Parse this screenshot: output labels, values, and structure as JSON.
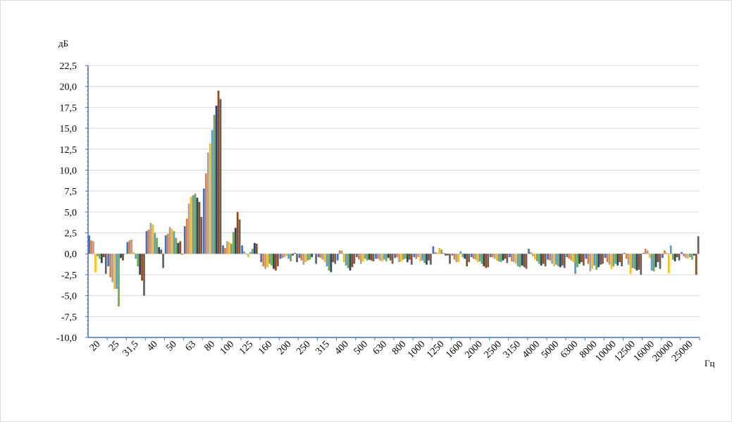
{
  "chart_data": {
    "type": "bar",
    "title": "",
    "ylabel": "дБ",
    "xlabel": "Гц",
    "ylim": [
      -10,
      22.5
    ],
    "yticks": [
      -10,
      -7.5,
      -5,
      -2.5,
      0,
      2.5,
      5,
      7.5,
      10,
      12.5,
      15,
      17.5,
      20,
      22.5
    ],
    "ytick_labels": [
      "-10,0",
      "-7,5",
      "-5,0",
      "-2,5",
      "0,0",
      "2,5",
      "5,0",
      "7,5",
      "10,0",
      "12,5",
      "15,0",
      "17,5",
      "20,0",
      "22,5"
    ],
    "grid": true,
    "legend": "none",
    "categories": [
      "20",
      "25",
      "31,5",
      "40",
      "50",
      "63",
      "80",
      "100",
      "125",
      "160",
      "200",
      "250",
      "315",
      "400",
      "500",
      "630",
      "800",
      "1000",
      "1250",
      "1600",
      "2000",
      "2500",
      "3150",
      "4000",
      "5000",
      "6300",
      "8000",
      "10000",
      "12500",
      "16000",
      "20000",
      "25000"
    ],
    "series_colors": [
      "#4472c4",
      "#ed7d31",
      "#a5a5a5",
      "#ffc000",
      "#5b9bd5",
      "#70ad47",
      "#264478",
      "#9e480e",
      "#636363"
    ],
    "values": [
      [
        2.2,
        1.6,
        1.5,
        -2.2,
        -0.3,
        -0.6,
        -1.1,
        -0.4,
        -2.4
      ],
      [
        -1.5,
        -2.8,
        -3.4,
        -4.2,
        -4.2,
        -6.3,
        -0.5,
        -0.8,
        0.0
      ],
      [
        1.4,
        1.6,
        1.7,
        0.2,
        -0.6,
        -1.5,
        -2.5,
        -3.2,
        -5.0
      ],
      [
        2.7,
        2.9,
        3.7,
        3.5,
        2.5,
        1.9,
        0.8,
        0.5,
        -1.7
      ],
      [
        2.2,
        2.4,
        3.2,
        3.0,
        2.7,
        1.9,
        1.3,
        1.5,
        -0.1
      ],
      [
        3.3,
        4.2,
        6.0,
        6.8,
        7.0,
        7.2,
        6.7,
        6.2,
        4.4
      ],
      [
        7.8,
        9.6,
        12.1,
        13.2,
        14.8,
        16.6,
        17.7,
        19.5,
        18.5
      ],
      [
        1.0,
        0.7,
        1.5,
        1.4,
        1.2,
        2.6,
        3.1,
        5.0,
        4.1
      ],
      [
        1.0,
        0.3,
        -0.1,
        -0.4,
        0.2,
        0.6,
        1.3,
        1.2,
        0.0
      ],
      [
        -1.0,
        -1.5,
        -1.8,
        -1.6,
        -1.2,
        -1.4,
        -1.8,
        -2.0,
        -1.5
      ],
      [
        -0.6,
        -0.5,
        -0.4,
        -0.3,
        -0.6,
        -0.9,
        -0.2,
        0.1,
        -1.0
      ],
      [
        -0.5,
        -0.8,
        -1.3,
        -1.0,
        -0.8,
        -0.7,
        -0.4,
        0.0,
        -1.2
      ],
      [
        -0.4,
        -0.5,
        -0.7,
        -1.0,
        -1.5,
        -2.0,
        -2.2,
        -1.0,
        -1.2
      ],
      [
        -0.8,
        0.4,
        0.4,
        -1.0,
        -1.4,
        -1.7,
        -2.0,
        -1.6,
        -1.2
      ],
      [
        -0.4,
        -0.7,
        -1.2,
        -0.9,
        -0.6,
        -0.8,
        -0.7,
        -0.8,
        -0.9
      ],
      [
        -0.6,
        -0.6,
        -0.8,
        -0.9,
        -0.7,
        -0.9,
        -0.5,
        -0.8,
        -1.2
      ],
      [
        -0.5,
        -0.4,
        -1.0,
        -0.9,
        -0.7,
        -0.6,
        -1.0,
        -0.7,
        -1.3
      ],
      [
        -0.4,
        -0.6,
        -0.4,
        -0.9,
        -0.8,
        -1.1,
        -1.3,
        -0.8,
        -1.3
      ],
      [
        0.9,
        0.2,
        0.1,
        0.7,
        0.5,
        0.1,
        -0.2,
        -0.2,
        -1.2
      ],
      [
        -0.2,
        -0.7,
        -1.0,
        -1.0,
        0.3,
        -0.4,
        -0.6,
        -1.5,
        -1.0
      ],
      [
        -0.4,
        -0.6,
        -0.7,
        -1.0,
        -0.9,
        -1.2,
        -1.5,
        -1.7,
        -1.6
      ],
      [
        -0.4,
        -0.4,
        -0.6,
        -0.8,
        -0.9,
        -1.0,
        -0.8,
        -0.6,
        -1.1
      ],
      [
        -0.4,
        -0.9,
        -1.0,
        -1.2,
        -1.5,
        -1.6,
        -1.4,
        -1.6,
        -1.8
      ],
      [
        0.6,
        0.2,
        -0.3,
        -0.7,
        -0.9,
        -1.2,
        -1.4,
        -1.2,
        -1.5
      ],
      [
        -0.7,
        -0.8,
        -1.2,
        -1.5,
        -1.3,
        -1.5,
        -1.6,
        -1.4,
        -1.7
      ],
      [
        -0.4,
        -0.6,
        -0.8,
        -1.0,
        -2.4,
        -1.6,
        -1.2,
        -1.0,
        -1.4
      ],
      [
        -0.6,
        -1.2,
        -2.1,
        -1.8,
        -1.4,
        -1.9,
        -1.6,
        -1.3,
        -1.2
      ],
      [
        -0.5,
        -1.0,
        -1.3,
        -1.8,
        -1.5,
        -1.2,
        -1.4,
        -1.0,
        -1.5
      ],
      [
        0.1,
        -0.6,
        -1.3,
        -2.4,
        -1.7,
        -1.8,
        -2.0,
        -1.9,
        -2.5
      ],
      [
        0.1,
        0.6,
        0.4,
        -0.5,
        -2.0,
        -2.1,
        -1.6,
        -1.0,
        -1.8
      ],
      [
        -0.5,
        0.4,
        0.1,
        -2.3,
        1.0,
        -0.7,
        -0.9,
        -0.4,
        -0.8
      ],
      [
        0.2,
        -0.3,
        -0.5,
        -0.6,
        -0.4,
        -0.7,
        -0.2,
        -2.5,
        2.1
      ]
    ]
  }
}
